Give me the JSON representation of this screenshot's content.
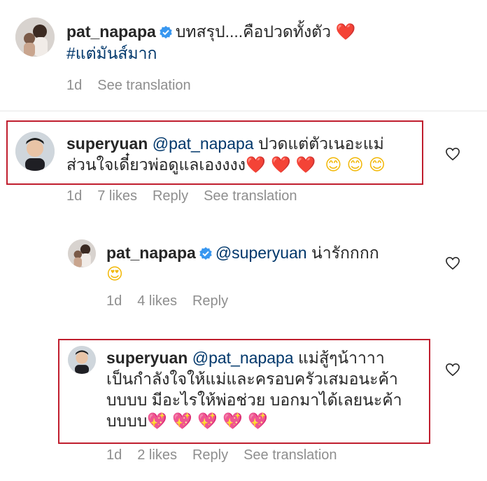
{
  "comments": [
    {
      "username": "pat_napapa",
      "line1": "บทสรุป....คือปวดทั้งตัว",
      "emoji1": "❤️",
      "line2": "#แต่มันส์มาก",
      "time": "1d",
      "translate": "See translation"
    },
    {
      "username": "superyuan",
      "mention": "@pat_napapa",
      "line1": "ปวดแต่ตัวเนอะแม่",
      "line2": "ส่วนใจเดี๋ยวพ่อดูแลเองงงง",
      "emoji_hearts": "❤️ ❤️ ❤️",
      "emoji_smiles": "😊 😊 😊",
      "time": "1d",
      "likes": "7 likes",
      "reply": "Reply",
      "translate": "See translation"
    },
    {
      "username": "pat_napapa",
      "mention": "@superyuan",
      "line1": "น่ารักกกก",
      "emoji": "😍",
      "time": "1d",
      "likes": "4 likes",
      "reply": "Reply"
    },
    {
      "username": "superyuan",
      "mention": "@pat_napapa",
      "line1": "แม่สู้ๆน้าาาา",
      "line2": "เป็นกำลังใจให้แม่และครอบครัวเสมอนะค้า",
      "line3": "บบบบ มีอะไรให้พ่อช่วย บอกมาได้เลยนะค้า",
      "line4": "บบบบ",
      "emoji": "💖 💖 💖 💖 💖",
      "time": "1d",
      "likes": "2 likes",
      "reply": "Reply",
      "translate": "See translation"
    }
  ],
  "colors": {
    "highlight_border": "#c01e2e",
    "verified_badge": "#3897f0",
    "link": "#00376b",
    "meta": "#8e8e8e"
  }
}
